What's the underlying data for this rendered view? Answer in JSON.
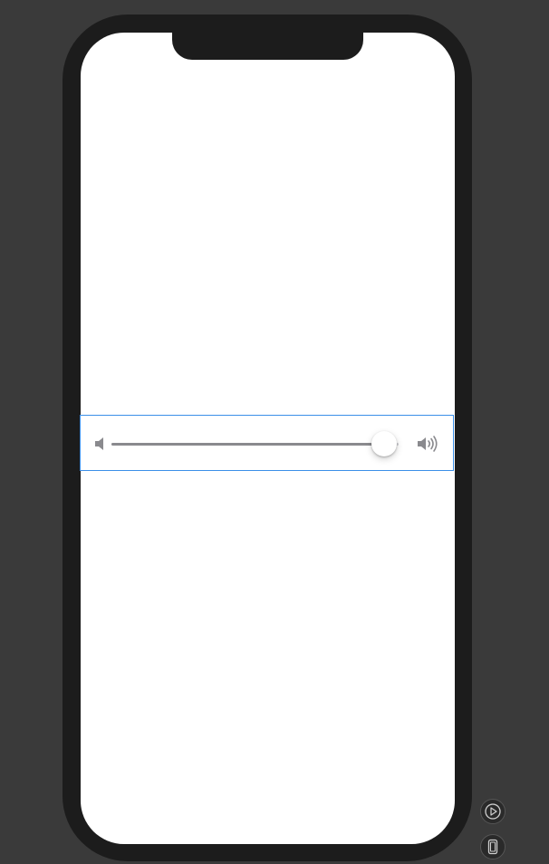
{
  "slider": {
    "value": 0.95,
    "min_icon": "speaker-low-icon",
    "max_icon": "speaker-high-icon",
    "fill_color": "#8a8a8e",
    "track_color": "#d1d1d6",
    "selection_color": "#3b8fe8"
  },
  "canvas_controls": {
    "live_preview_icon": "play-circle-icon",
    "device_settings_icon": "device-icon"
  }
}
